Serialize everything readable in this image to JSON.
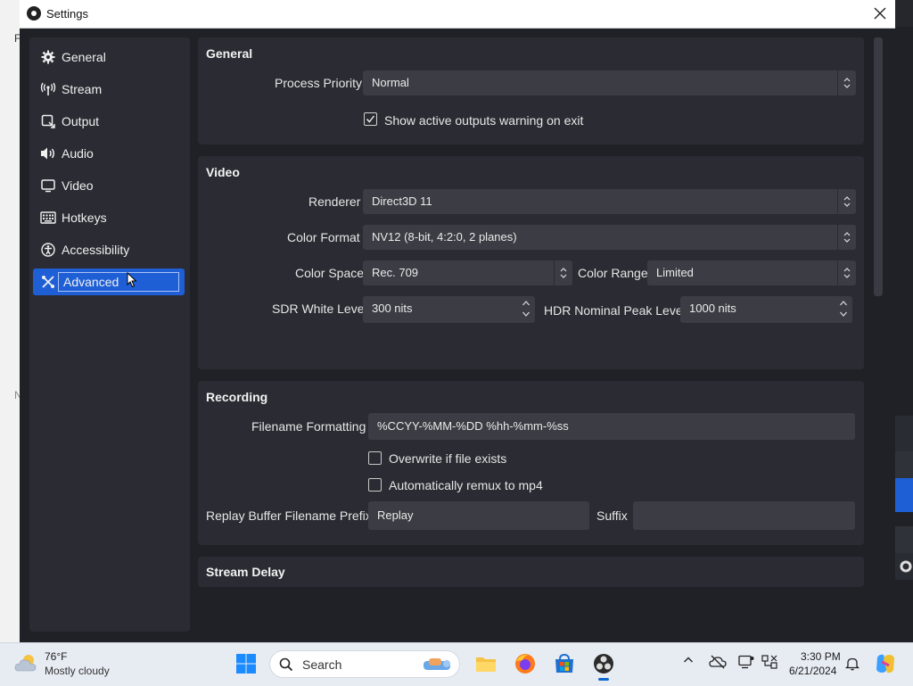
{
  "window": {
    "title": "Settings"
  },
  "sidebar": {
    "items": [
      {
        "label": "General",
        "icon": "gear-icon"
      },
      {
        "label": "Stream",
        "icon": "antenna-icon"
      },
      {
        "label": "Output",
        "icon": "output-icon"
      },
      {
        "label": "Audio",
        "icon": "speaker-icon"
      },
      {
        "label": "Video",
        "icon": "monitor-icon"
      },
      {
        "label": "Hotkeys",
        "icon": "keyboard-icon"
      },
      {
        "label": "Accessibility",
        "icon": "accessibility-icon"
      },
      {
        "label": "Advanced",
        "icon": "tools-icon"
      }
    ],
    "active": "Advanced"
  },
  "general": {
    "title": "General",
    "process_priority_label": "Process Priority",
    "process_priority_value": "Normal",
    "show_warning_label": "Show active outputs warning on exit",
    "show_warning_checked": true
  },
  "video": {
    "title": "Video",
    "renderer_label": "Renderer",
    "renderer_value": "Direct3D 11",
    "color_format_label": "Color Format",
    "color_format_value": "NV12 (8-bit, 4:2:0, 2 planes)",
    "color_space_label": "Color Space",
    "color_space_value": "Rec. 709",
    "color_range_label": "Color Range",
    "color_range_value": "Limited",
    "sdr_label": "SDR White Level",
    "sdr_value": "300 nits",
    "hdr_label": "HDR Nominal Peak Level",
    "hdr_value": "1000 nits"
  },
  "recording": {
    "title": "Recording",
    "filename_label": "Filename Formatting",
    "filename_value": "%CCYY-%MM-%DD %hh-%mm-%ss",
    "overwrite_label": "Overwrite if file exists",
    "overwrite_checked": false,
    "remux_label": "Automatically remux to mp4",
    "remux_checked": false,
    "replay_prefix_label": "Replay Buffer Filename Prefix",
    "replay_prefix_value": "Replay",
    "suffix_label": "Suffix",
    "suffix_value": ""
  },
  "stream_delay": {
    "title": "Stream Delay"
  },
  "taskbar": {
    "weather_temp": "76°F",
    "weather_desc": "Mostly cloudy",
    "search_placeholder": "Search",
    "time": "3:30 PM",
    "date": "6/21/2024"
  },
  "colors": {
    "accent": "#1f5fd6",
    "panel": "#2b2c33",
    "window_bg": "#1f2127",
    "input_bg": "#3c3d44"
  }
}
